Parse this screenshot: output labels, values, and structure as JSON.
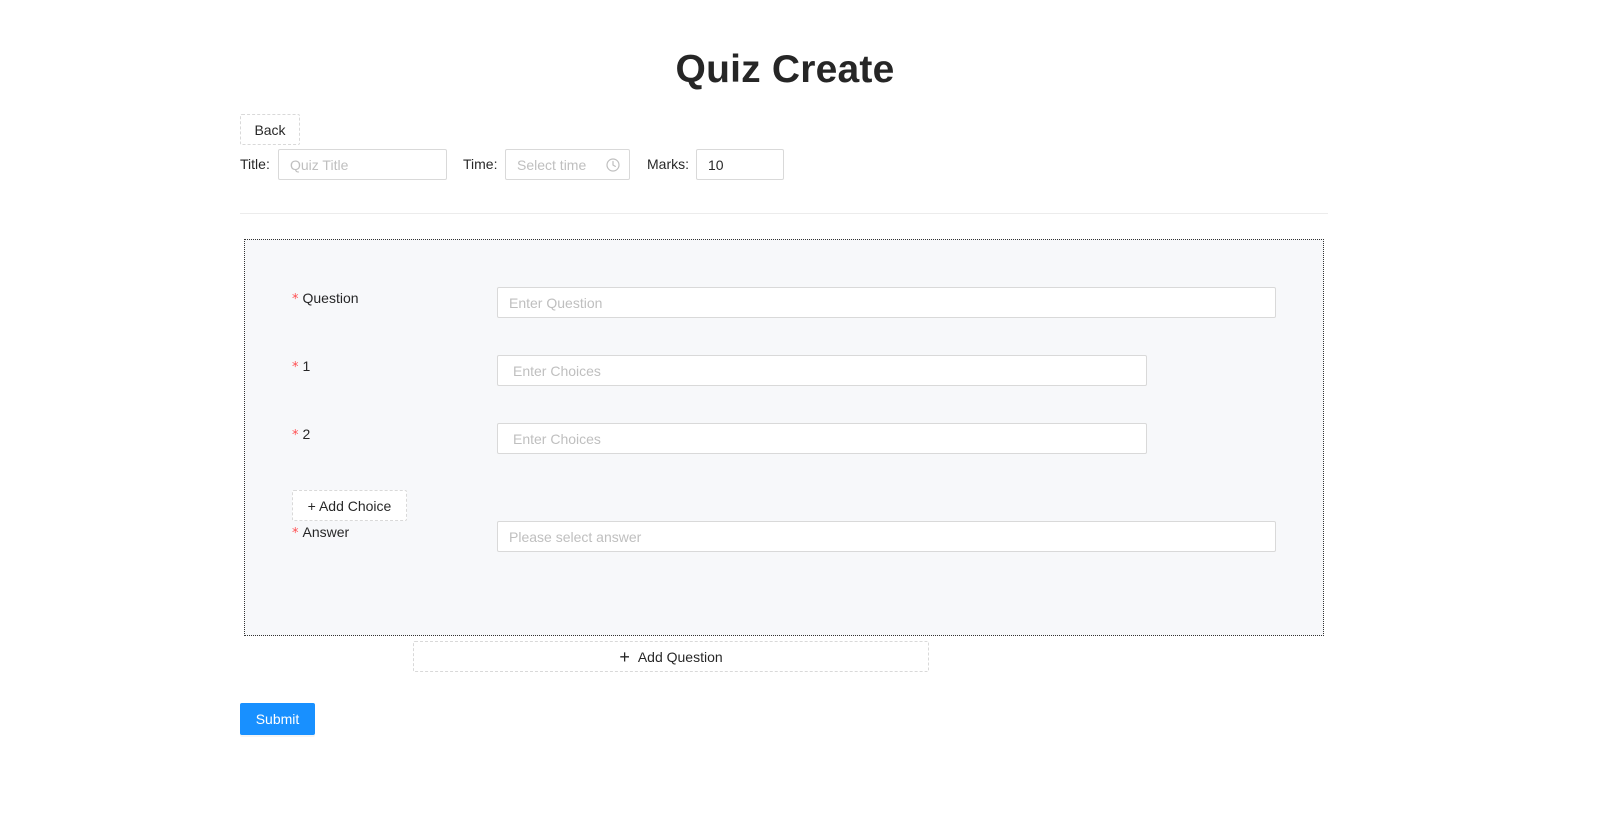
{
  "page": {
    "title": "Quiz Create"
  },
  "toolbar": {
    "back_label": "Back",
    "title_label": "Title",
    "title_placeholder": "Quiz Title",
    "time_label": "Time",
    "time_placeholder": "Select time",
    "marks_label": "Marks",
    "marks_value": "10"
  },
  "question_card": {
    "question_label": "Question",
    "question_placeholder": "Enter Question",
    "choices": [
      {
        "label": "1",
        "placeholder": "Enter Choices"
      },
      {
        "label": "2",
        "placeholder": "Enter Choices"
      }
    ],
    "add_choice_label": "+ Add Choice",
    "answer_label": "Answer",
    "answer_placeholder": "Please select answer",
    "required_mark": "*"
  },
  "actions": {
    "add_question_label": "Add Question",
    "add_question_icon": "+",
    "submit_label": "Submit"
  },
  "colors": {
    "primary": "#1890ff",
    "required": "#ff4d4f",
    "card_background": "#f7f8fa"
  },
  "icons": {
    "time_picker": "clock-icon"
  }
}
